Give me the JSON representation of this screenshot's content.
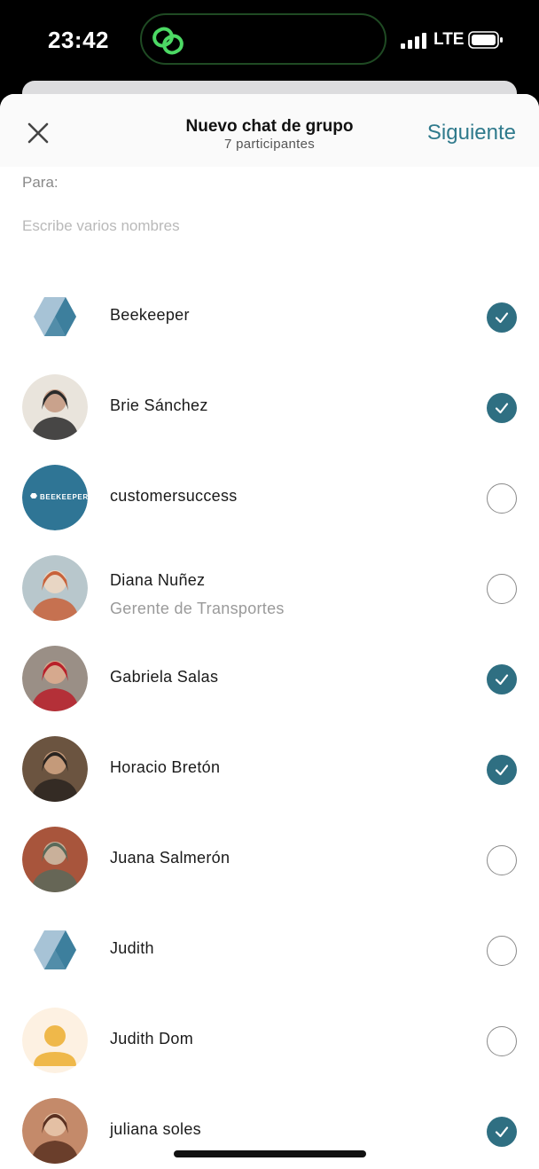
{
  "status_bar": {
    "time": "23:42",
    "network": "LTE",
    "island_icon": "link-rings-icon",
    "island_icon_color": "#4cd964"
  },
  "header": {
    "title": "Nuevo chat de grupo",
    "subtitle": "7 participantes",
    "next_label": "Siguiente",
    "close_icon": "close-icon",
    "accent_color": "#2f7a8c"
  },
  "recipient": {
    "label": "Para:",
    "placeholder": "Escribe varios nombres",
    "value": ""
  },
  "contacts": [
    {
      "name": "Beekeeper",
      "subtitle": "",
      "selected": true,
      "avatar": "hexagon-logo"
    },
    {
      "name": "Brie Sánchez",
      "subtitle": "",
      "selected": true,
      "avatar": "photo"
    },
    {
      "name": "customersuccess",
      "subtitle": "",
      "selected": false,
      "avatar": "beekeeper-badge",
      "avatar_text": "BEEKEEPER"
    },
    {
      "name": "Diana Nuñez",
      "subtitle": "Gerente de Transportes",
      "selected": false,
      "avatar": "photo"
    },
    {
      "name": "Gabriela Salas",
      "subtitle": "",
      "selected": true,
      "avatar": "photo"
    },
    {
      "name": "Horacio Bretón",
      "subtitle": "",
      "selected": true,
      "avatar": "photo"
    },
    {
      "name": "Juana Salmerón",
      "subtitle": "",
      "selected": false,
      "avatar": "photo"
    },
    {
      "name": "Judith",
      "subtitle": "",
      "selected": false,
      "avatar": "hexagon-logo"
    },
    {
      "name": "Judith Dom",
      "subtitle": "",
      "selected": false,
      "avatar": "default-person"
    },
    {
      "name": "juliana soles",
      "subtitle": "",
      "selected": true,
      "avatar": "photo"
    }
  ],
  "colors": {
    "selected_check": "#2f6f82",
    "hexagon_light": "#a7c3d6",
    "hexagon_dark": "#3d7f9d",
    "badge_bg": "#2f7595",
    "default_avatar_bg": "#fdf1e2",
    "default_avatar_fg": "#efb84a"
  }
}
